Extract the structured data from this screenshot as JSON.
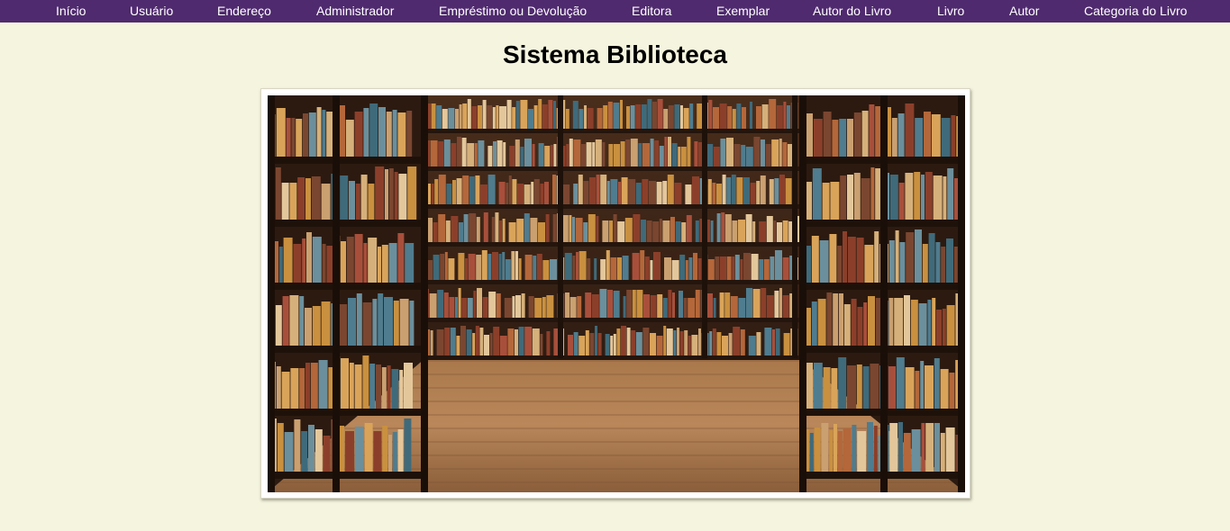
{
  "nav": {
    "items": [
      {
        "label": "Início"
      },
      {
        "label": "Usuário"
      },
      {
        "label": "Endereço"
      },
      {
        "label": "Administrador"
      },
      {
        "label": "Empréstimo ou Devolução"
      },
      {
        "label": "Editora"
      },
      {
        "label": "Exemplar"
      },
      {
        "label": "Autor do Livro"
      },
      {
        "label": "Livro"
      },
      {
        "label": "Autor"
      },
      {
        "label": "Categoria do Livro"
      }
    ]
  },
  "page": {
    "title": "Sistema Biblioteca"
  },
  "colors": {
    "nav_background": "#4f2a6e",
    "page_background": "#f5f4de"
  }
}
